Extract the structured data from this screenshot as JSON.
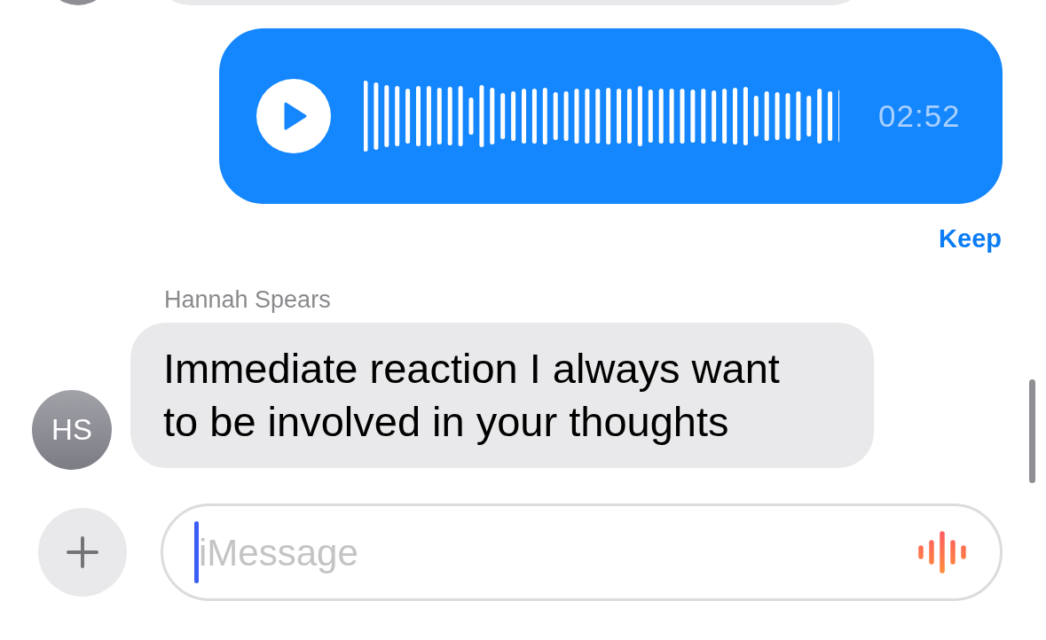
{
  "voice_message": {
    "duration": "02:52",
    "status": "Keep"
  },
  "incoming_message": {
    "sender": "Hannah Spears",
    "avatar_initials": "HS",
    "text": "Immediate reaction I always want to be involved in your thoughts"
  },
  "composer": {
    "placeholder": "iMessage"
  }
}
